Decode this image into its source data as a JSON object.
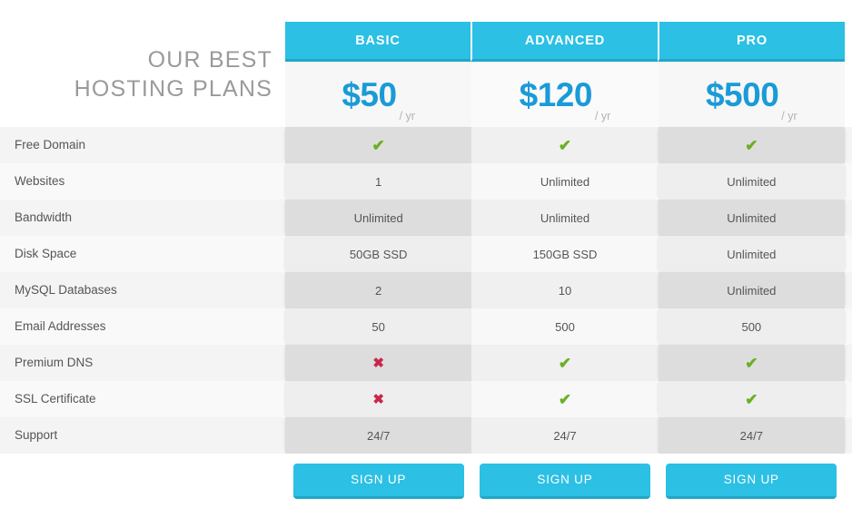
{
  "heading": {
    "line1": "OUR BEST",
    "line2": "HOSTING PLANS"
  },
  "colors": {
    "accent": "#2bc0e4",
    "accent_dark": "#1fa8c9",
    "price": "#1a9bd7",
    "yes": "#6ab023",
    "no": "#c9264b",
    "heading_text": "#9a9a9a"
  },
  "plans": [
    {
      "name": "BASIC",
      "price": "$50",
      "period": "/ yr",
      "cta": "SIGN UP",
      "highlight": true
    },
    {
      "name": "ADVANCED",
      "price": "$120",
      "period": "/ yr",
      "cta": "SIGN UP",
      "highlight": false
    },
    {
      "name": "PRO",
      "price": "$500",
      "period": "/ yr",
      "cta": "SIGN UP",
      "highlight": true
    }
  ],
  "features": [
    {
      "label": "Free Domain",
      "values": [
        "yes",
        "yes",
        "yes"
      ]
    },
    {
      "label": "Websites",
      "values": [
        "1",
        "Unlimited",
        "Unlimited"
      ]
    },
    {
      "label": "Bandwidth",
      "values": [
        "Unlimited",
        "Unlimited",
        "Unlimited"
      ]
    },
    {
      "label": "Disk Space",
      "values": [
        "50GB SSD",
        "150GB SSD",
        "Unlimited"
      ]
    },
    {
      "label": "MySQL Databases",
      "values": [
        "2",
        "10",
        "Unlimited"
      ]
    },
    {
      "label": "Email Addresses",
      "values": [
        "50",
        "500",
        "500"
      ]
    },
    {
      "label": "Premium DNS",
      "values": [
        "no",
        "yes",
        "yes"
      ]
    },
    {
      "label": "SSL Certificate",
      "values": [
        "no",
        "yes",
        "yes"
      ]
    },
    {
      "label": "Support",
      "values": [
        "24/7",
        "24/7",
        "24/7"
      ]
    }
  ],
  "glyphs": {
    "yes": "✔",
    "no": "✖"
  }
}
